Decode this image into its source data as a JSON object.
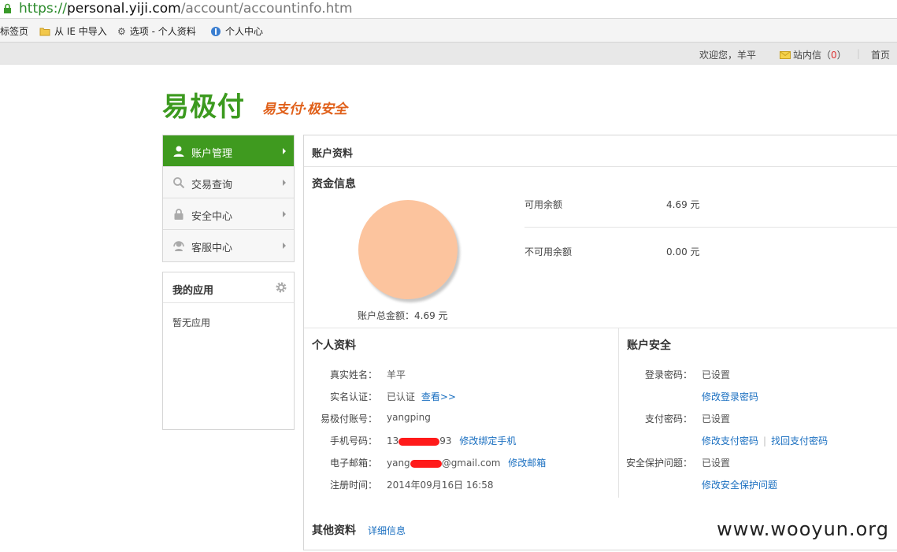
{
  "browser": {
    "url_scheme": "https://",
    "url_host": "personal.yiji.com",
    "url_path": "/account/accountinfo.htm",
    "favorites": [
      "标签页",
      "从 IE 中导入",
      "选项 - 个人资料",
      "个人中心"
    ]
  },
  "topbar": {
    "welcome": "欢迎您，羊平",
    "mail_label": "站内信",
    "mail_open": "（",
    "mail_count": "0",
    "mail_close": "）",
    "home": "首页"
  },
  "brand": {
    "logo": "易极付",
    "slogan": "易支付·极安全",
    "accent": "#3c9a1f",
    "slogan_color": "#e0601a"
  },
  "nav": {
    "items": [
      {
        "label": "账户管理",
        "icon": "user-icon",
        "active": true
      },
      {
        "label": "交易查询",
        "icon": "search-icon",
        "active": false
      },
      {
        "label": "安全中心",
        "icon": "lock-icon",
        "active": false
      },
      {
        "label": "客服中心",
        "icon": "headset-icon",
        "active": false
      }
    ]
  },
  "apps": {
    "title": "我的应用",
    "empty": "暂无应用"
  },
  "main": {
    "title": "账户资料",
    "funds": {
      "title": "资金信息",
      "total_label": "账户总金额：4.69 元",
      "available_label": "可用余额",
      "available_value": "4.69 元",
      "unavailable_label": "不可用余额",
      "unavailable_value": "0.00 元",
      "pie_color": "#fcc49e"
    },
    "profile": {
      "title": "个人资料",
      "rows": [
        {
          "label": "真实姓名：",
          "value": "羊平"
        },
        {
          "label": "实名认证：",
          "value": "已认证",
          "link": "查看>>"
        },
        {
          "label": "易极付账号：",
          "value": "yangping"
        },
        {
          "label": "手机号码：",
          "value_prefix": "13",
          "value_suffix": "93",
          "link": "修改绑定手机"
        },
        {
          "label": "电子邮箱：",
          "value_prefix": "yang",
          "value_suffix": "@gmail.com",
          "link": "修改邮箱"
        },
        {
          "label": "注册时间：",
          "value": "2014年09月16日 16:58"
        }
      ]
    },
    "security": {
      "title": "账户安全",
      "login_label": "登录密码：",
      "login_value": "已设置",
      "login_link": "修改登录密码",
      "pay_label": "支付密码：",
      "pay_value": "已设置",
      "pay_link1": "修改支付密码",
      "pay_sep": "|",
      "pay_link2": "找回支付密码",
      "question_label": "安全保护问题：",
      "question_value": "已设置",
      "question_link": "修改安全保护问题"
    },
    "other": {
      "title": "其他资料",
      "link": "详细信息"
    }
  },
  "watermark": "www.wooyun.org"
}
